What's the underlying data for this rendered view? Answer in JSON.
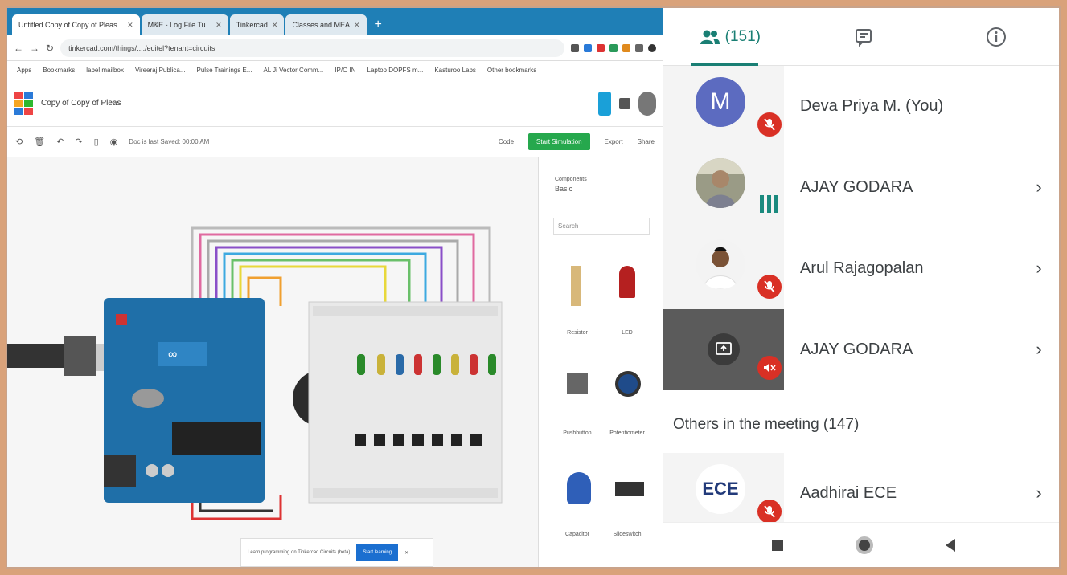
{
  "browser": {
    "tabs": [
      "Untitled Copy of Copy of Pleas...",
      "M&E - Log File Tu...",
      "Tinkercad",
      "Classes and MEA"
    ],
    "url": "tinkercad.com/things/..../editel?tenant=circuits",
    "bookmarks": [
      "Apps",
      "Bookmarks",
      "label mailbox",
      "Vireeraj Publica...",
      "Pulse Trainings E...",
      "AL Ji Vector Comm...",
      "IP/O IN",
      "Laptop DOPFS m...",
      "Kasturoo Labs",
      "Other bookmarks"
    ]
  },
  "tinkercad": {
    "doc_name": "Copy of Copy of Pleas",
    "toolbar_info": "Doc is last Saved: 00:00 AM",
    "code_label": "Code",
    "start_label": "Start Simulation",
    "export_label": "Export",
    "share_label": "Share",
    "components_label": "Components",
    "components_value": "Basic",
    "search_placeholder": "Search",
    "components": [
      "Resistor",
      "LED",
      "Pushbutton",
      "Potentiometer",
      "Capacitor",
      "Slideswitch"
    ],
    "bottom_text": "Learn programming on Tinkercad Circuits (beta)",
    "bottom_button": "Start learning",
    "bottom_close": "✕"
  },
  "meeting": {
    "people_count": "(151)",
    "participants": [
      {
        "name": "Deva Priya M. (You)",
        "initial": "M",
        "status": "muted"
      },
      {
        "name": "AJAY GODARA",
        "status": "speaking"
      },
      {
        "name": "Arul Rajagopalan",
        "status": "muted"
      },
      {
        "name": "AJAY GODARA",
        "status": "presenting"
      }
    ],
    "others_heading": "Others in the meeting (147)",
    "others": [
      {
        "name": "Aadhirai ECE",
        "initials": "ECE",
        "status": "muted"
      }
    ],
    "colors": {
      "accent": "#1a7f74",
      "mute": "#d93025",
      "avatar_m": "#5c6bc0"
    }
  }
}
